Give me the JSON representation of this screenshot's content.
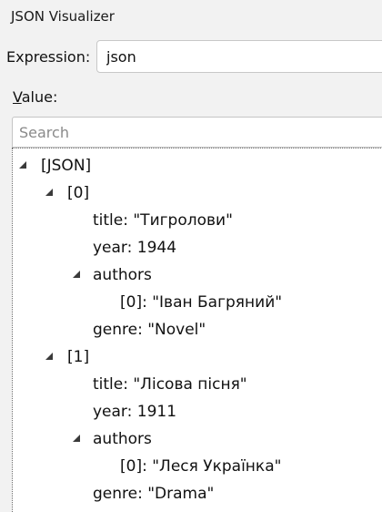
{
  "window": {
    "title": "JSON Visualizer"
  },
  "expression": {
    "label": "Expression:",
    "value": "json"
  },
  "value_section": {
    "label_accesskey": "V",
    "label_rest": "alue:"
  },
  "search": {
    "placeholder": "Search",
    "value": ""
  },
  "tree": {
    "root": "[JSON]",
    "items": [
      {
        "index": "[0]",
        "title": "title: \"Тигролови\"",
        "year": "year: 1944",
        "authors_label": "authors",
        "author_0": "[0]: \"Іван Багряний\"",
        "genre": "genre: \"Novel\""
      },
      {
        "index": "[1]",
        "title": "title: \"Лісова пісня\"",
        "year": "year: 1911",
        "authors_label": "authors",
        "author_0": "[0]: \"Леся Українка\"",
        "genre": "genre: \"Drama\""
      }
    ]
  }
}
